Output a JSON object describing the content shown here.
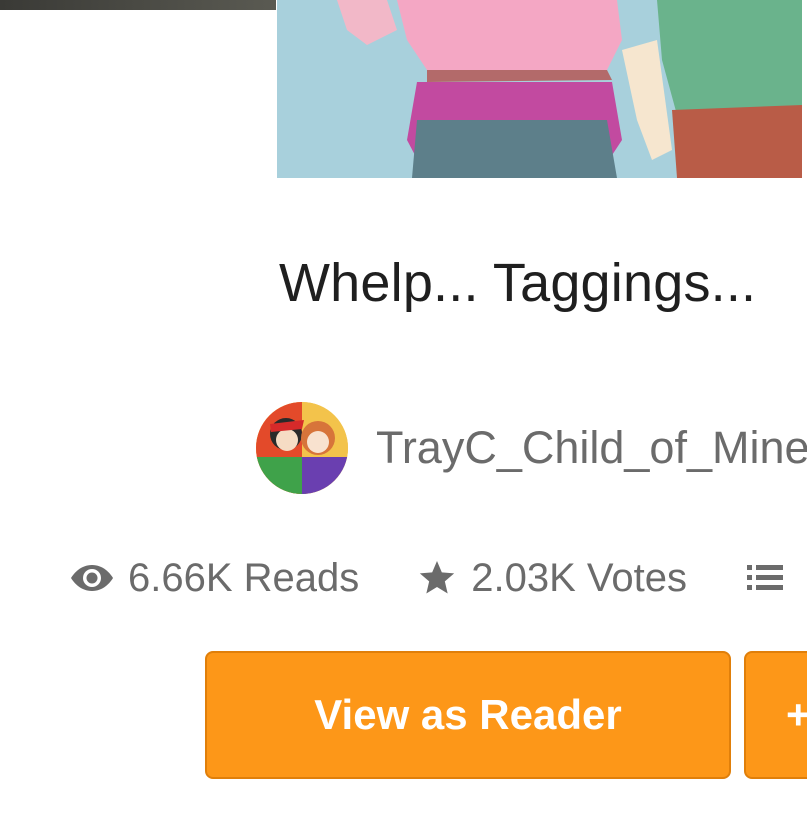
{
  "story": {
    "title": "Whelp... Taggings...",
    "author": "TrayC_Child_of_Mine",
    "cover_image": "anime-couple-cover-art",
    "avatar_image": "anime-couple-avatar"
  },
  "stats": {
    "reads": "6.66K Reads",
    "votes": "2.03K Votes",
    "reads_icon": "eye-icon",
    "votes_icon": "star-icon",
    "parts_icon": "list-icon"
  },
  "actions": {
    "view_as_reader": "View as Reader",
    "add_label": "+"
  },
  "colors": {
    "accent": "#fd9718",
    "text_primary": "#1f1f1f",
    "text_secondary": "#6b6b6b"
  }
}
